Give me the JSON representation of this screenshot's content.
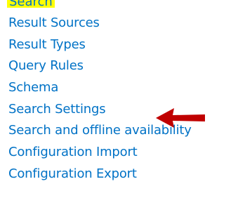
{
  "section": {
    "header_label": "Search",
    "header_highlight_color": "#ffff00"
  },
  "links": [
    {
      "label": "Result Sources"
    },
    {
      "label": "Result Types"
    },
    {
      "label": "Query Rules"
    },
    {
      "label": "Schema"
    },
    {
      "label": "Search Settings"
    },
    {
      "label": "Search and offline availability"
    },
    {
      "label": "Configuration Import"
    },
    {
      "label": "Configuration Export"
    }
  ],
  "annotation": {
    "icon": "red-left-arrow-icon",
    "points_to": "Search Settings",
    "color": "#c00000"
  },
  "colors": {
    "link": "#0072c6",
    "background": "#ffffff"
  }
}
